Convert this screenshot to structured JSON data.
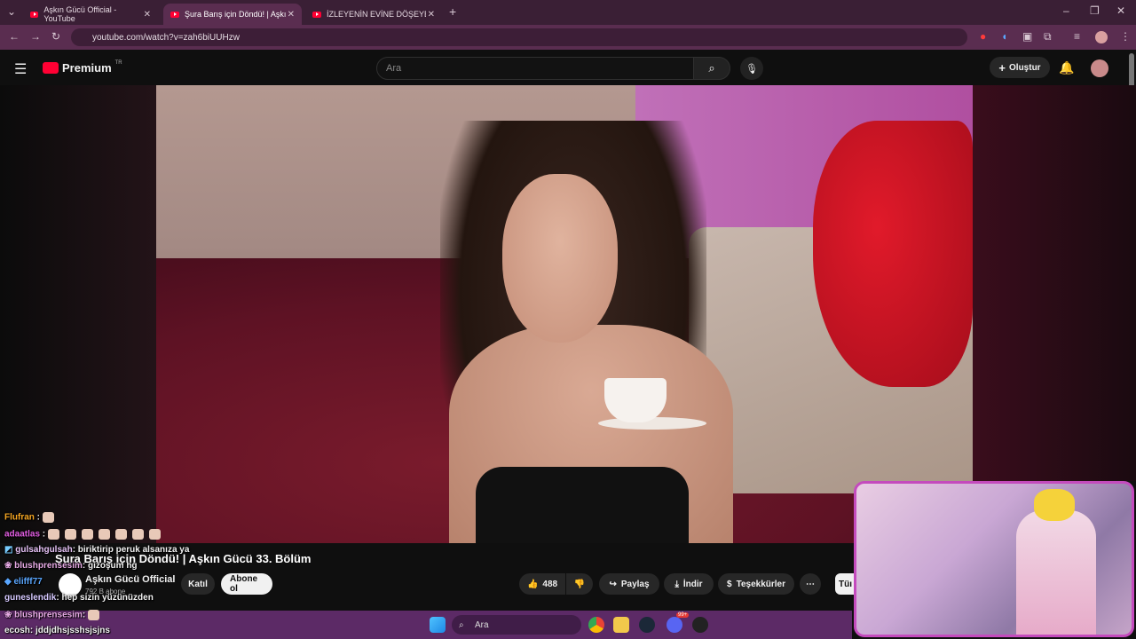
{
  "browser": {
    "tabs": [
      {
        "title": "Aşkın Gücü Official - YouTube",
        "active": false
      },
      {
        "title": "Şura Barış için Döndü! | Aşkın G",
        "active": true
      },
      {
        "title": "İZLEYENİN EVİNE DÖŞEYEN KI",
        "active": false
      }
    ],
    "url": "youtube.com/watch?v=zah6biUUHzw"
  },
  "youtube": {
    "logo_text": "Premium",
    "logo_region": "TR",
    "search_placeholder": "Ara",
    "create_label": "Oluştur",
    "video_title": "Şura Barış için Döndü! | Aşkın Gücü 33. Bölüm",
    "channel_name": "Aşkın Gücü Official",
    "subscribers": "792 B abone",
    "join_label": "Katıl",
    "subscribe_label": "Abone ol",
    "like_count": "488",
    "share_label": "Paylaş",
    "download_label": "İndir",
    "thanks_label": "Teşekkürler",
    "side_button": "Tüı"
  },
  "chat": [
    {
      "user": "Flufran",
      "text": "",
      "color": "#f5a623"
    },
    {
      "user": "adaatlas",
      "text": "",
      "color": "#e05de0"
    },
    {
      "user": "gulsahgulsah",
      "text": ": biriktirip peruk alsanıza ya",
      "color": "#e5c1f5"
    },
    {
      "user": "blushprensesim",
      "text": ": gizoşum hg",
      "color": "#e5a9e3"
    },
    {
      "user": "elifff77",
      "text": "",
      "color": "#5aa7ff"
    },
    {
      "user": "guneslendik",
      "text": ": hep sizin yüzünüzden",
      "color": "#d6c9ff"
    },
    {
      "user": "blushprensesim",
      "text": ":",
      "color": "#e5a9e3"
    },
    {
      "user": "ecosh",
      "text": ": jddjdhsjsshsjsjns",
      "color": "#ffffff"
    }
  ],
  "taskbar": {
    "search_placeholder": "Ara",
    "badge": "99+"
  },
  "colors": {
    "tab_bar": "#3a1f35",
    "address_bar": "#5a2d50",
    "youtube_red": "#ff0033",
    "webcam_border": "#c44bbd",
    "taskbar": "#5c2a66"
  }
}
